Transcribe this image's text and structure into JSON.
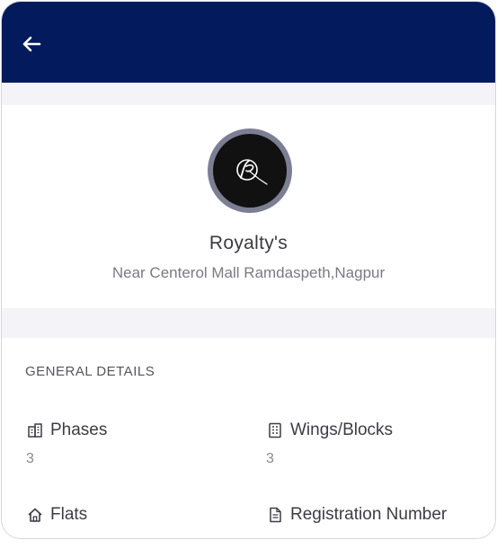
{
  "header": {
    "back_icon": "arrow-left-icon",
    "background_color": "#031a5c"
  },
  "profile": {
    "logo_icon": "royaltys-logo",
    "name": "Royalty's",
    "address": "Near Centerol Mall Ramdaspeth,Nagpur"
  },
  "details": {
    "section_title": "GENERAL DETAILS",
    "fields": [
      {
        "label": "Phases",
        "value": "3",
        "icon": "building-icon"
      },
      {
        "label": "Wings/Blocks",
        "value": "3",
        "icon": "grid-building-icon"
      },
      {
        "label": "Flats",
        "value": "",
        "icon": "home-icon"
      },
      {
        "label": "Registration Number",
        "value": "",
        "icon": "document-icon"
      }
    ]
  }
}
